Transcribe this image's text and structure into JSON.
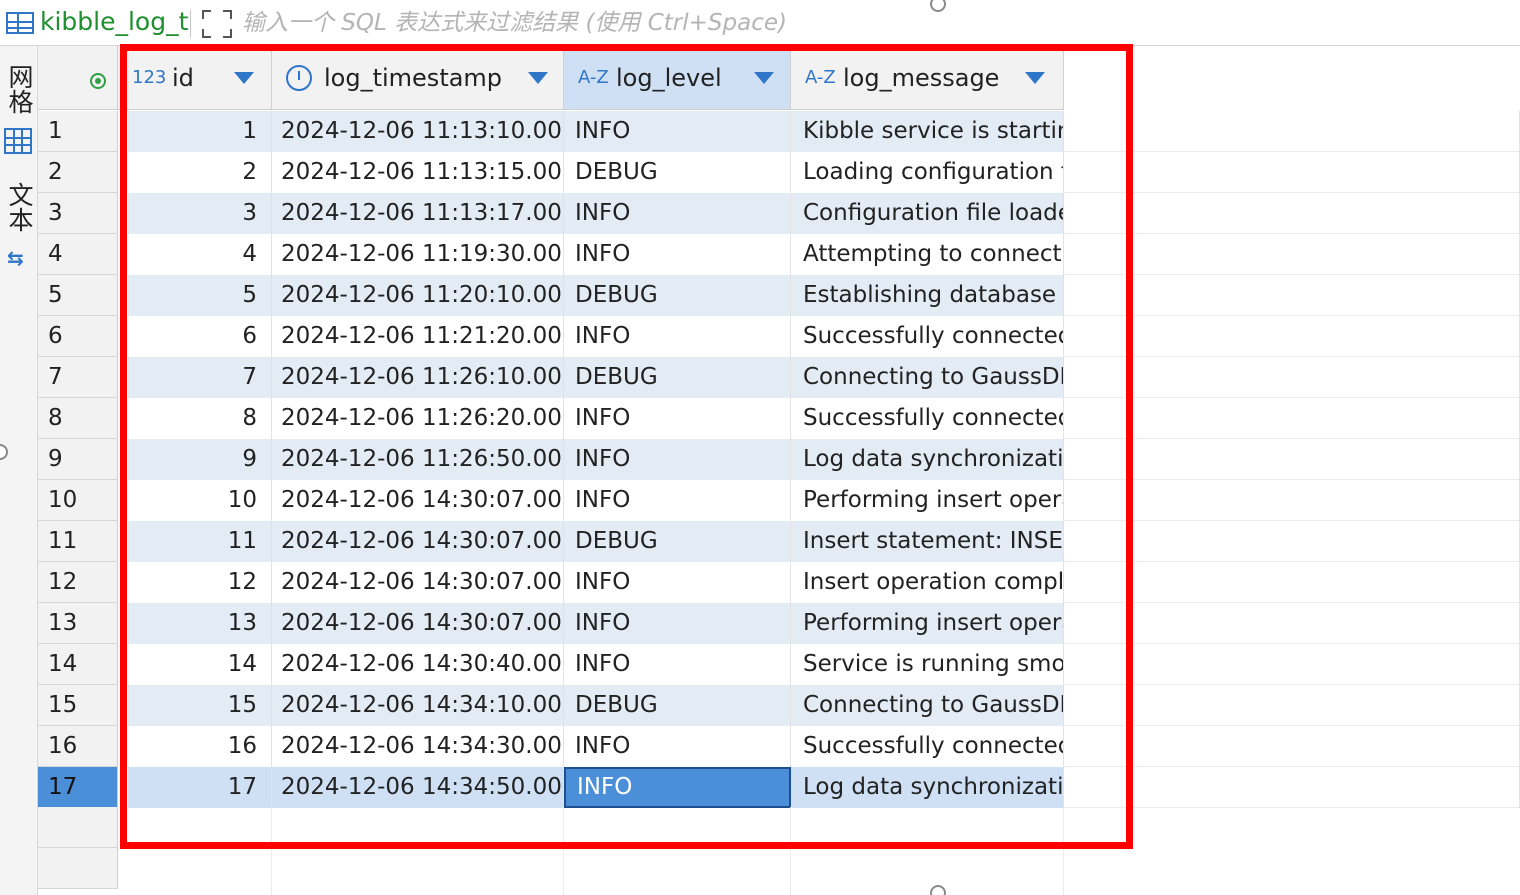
{
  "toolbar": {
    "table_name": "kibble_log_t",
    "filter_placeholder": "输入一个 SQL 表达式来过滤结果 (使用 Ctrl+Space)"
  },
  "side_tabs": [
    {
      "label": "网格",
      "icon": "grid-icon"
    },
    {
      "label": "文本",
      "icon": "text-icon"
    }
  ],
  "grid": {
    "columns": [
      {
        "name": "id",
        "type_icon": "123"
      },
      {
        "name": "log_timestamp",
        "type_icon": "clock"
      },
      {
        "name": "log_level",
        "type_icon": "A-Z"
      },
      {
        "name": "log_message",
        "type_icon": "A-Z"
      }
    ],
    "selected_column": "log_level",
    "rows": [
      {
        "n": "1",
        "id": "1",
        "ts": "2024-12-06 11:13:10.000",
        "level": "INFO",
        "msg": "Kibble service is starting"
      },
      {
        "n": "2",
        "id": "2",
        "ts": "2024-12-06 11:13:15.000",
        "level": "DEBUG",
        "msg": "Loading configuration fi"
      },
      {
        "n": "3",
        "id": "3",
        "ts": "2024-12-06 11:13:17.000",
        "level": "INFO",
        "msg": "Configuration file loade"
      },
      {
        "n": "4",
        "id": "4",
        "ts": "2024-12-06 11:19:30.000",
        "level": "INFO",
        "msg": "Attempting to connect t"
      },
      {
        "n": "5",
        "id": "5",
        "ts": "2024-12-06 11:20:10.000",
        "level": "DEBUG",
        "msg": "Establishing database cc"
      },
      {
        "n": "6",
        "id": "6",
        "ts": "2024-12-06 11:21:20.000",
        "level": "INFO",
        "msg": "Successfully connected"
      },
      {
        "n": "7",
        "id": "7",
        "ts": "2024-12-06 11:26:10.000",
        "level": "DEBUG",
        "msg": "Connecting to GaussDB"
      },
      {
        "n": "8",
        "id": "8",
        "ts": "2024-12-06 11:26:20.000",
        "level": "INFO",
        "msg": "Successfully connected"
      },
      {
        "n": "9",
        "id": "9",
        "ts": "2024-12-06 11:26:50.000",
        "level": "INFO",
        "msg": "Log data synchronizatio"
      },
      {
        "n": "10",
        "id": "10",
        "ts": "2024-12-06 14:30:07.000",
        "level": "INFO",
        "msg": "Performing insert opera"
      },
      {
        "n": "11",
        "id": "11",
        "ts": "2024-12-06 14:30:07.000",
        "level": "DEBUG",
        "msg": "Insert statement: INSERT"
      },
      {
        "n": "12",
        "id": "12",
        "ts": "2024-12-06 14:30:07.000",
        "level": "INFO",
        "msg": "Insert operation comple"
      },
      {
        "n": "13",
        "id": "13",
        "ts": "2024-12-06 14:30:07.000",
        "level": "INFO",
        "msg": "Performing insert opera"
      },
      {
        "n": "14",
        "id": "14",
        "ts": "2024-12-06 14:30:40.000",
        "level": "INFO",
        "msg": "Service is running smoo"
      },
      {
        "n": "15",
        "id": "15",
        "ts": "2024-12-06 14:34:10.000",
        "level": "DEBUG",
        "msg": "Connecting to GaussDB"
      },
      {
        "n": "16",
        "id": "16",
        "ts": "2024-12-06 14:34:30.000",
        "level": "INFO",
        "msg": "Successfully connected"
      },
      {
        "n": "17",
        "id": "17",
        "ts": "2024-12-06 14:34:50.000",
        "level": "INFO",
        "msg": "Log data synchronizatio"
      }
    ],
    "active_row": "17",
    "focused_cell": "log_level"
  },
  "colors": {
    "highlight_box": "#ff0000",
    "selection": "#4a8fd8",
    "alt_row": "#e3ebf5",
    "accent": "#2f76c8"
  }
}
